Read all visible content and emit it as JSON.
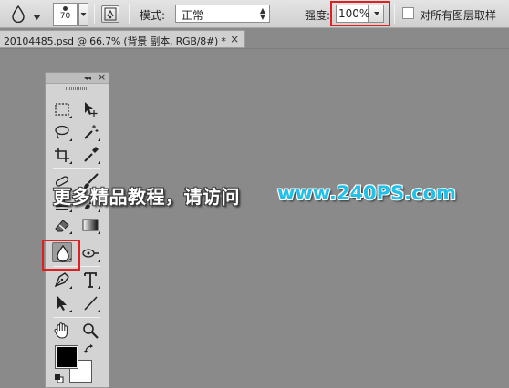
{
  "options_bar": {
    "tool_preset_icon": "blur-drop-icon",
    "brush_size": "70",
    "brush_panel_icon": "brush-panel-icon",
    "mode_label": "模式:",
    "mode_value": "正常",
    "strength_label": "强度:",
    "strength_value": "100%",
    "sample_all_layers_label": "对所有图层取样",
    "sample_all_layers_checked": false
  },
  "document_tab": {
    "title": "20104485.psd @ 66.7% (背景 副本, RGB/8#) *",
    "close_glyph": "×"
  },
  "tools_panel": {
    "collapse_glyph": "◂◂",
    "close_glyph": "×",
    "tools": [
      {
        "name": "rectangular-marquee-icon"
      },
      {
        "name": "move-icon"
      },
      {
        "name": "lasso-icon"
      },
      {
        "name": "magic-wand-icon"
      },
      {
        "name": "crop-icon"
      },
      {
        "name": "eyedropper-icon"
      },
      {
        "name": "spot-healing-icon"
      },
      {
        "name": "brush-icon"
      },
      {
        "name": "clone-stamp-icon"
      },
      {
        "name": "history-brush-icon"
      },
      {
        "name": "eraser-icon"
      },
      {
        "name": "gradient-icon"
      },
      {
        "name": "blur-icon",
        "active": true
      },
      {
        "name": "dodge-icon"
      },
      {
        "name": "pen-icon"
      },
      {
        "name": "type-icon",
        "glyph": "T"
      },
      {
        "name": "path-selection-icon"
      },
      {
        "name": "line-icon"
      },
      {
        "name": "hand-icon"
      },
      {
        "name": "zoom-icon"
      }
    ],
    "foreground_color": "#000000",
    "background_color": "#ffffff"
  },
  "watermark": {
    "text": "更多精品教程，请访问",
    "url": "www.240PS.com",
    "url_color": "#21c0e8"
  },
  "colors": {
    "highlight": "#e02020",
    "canvas_bg": "#8a8a8a"
  }
}
